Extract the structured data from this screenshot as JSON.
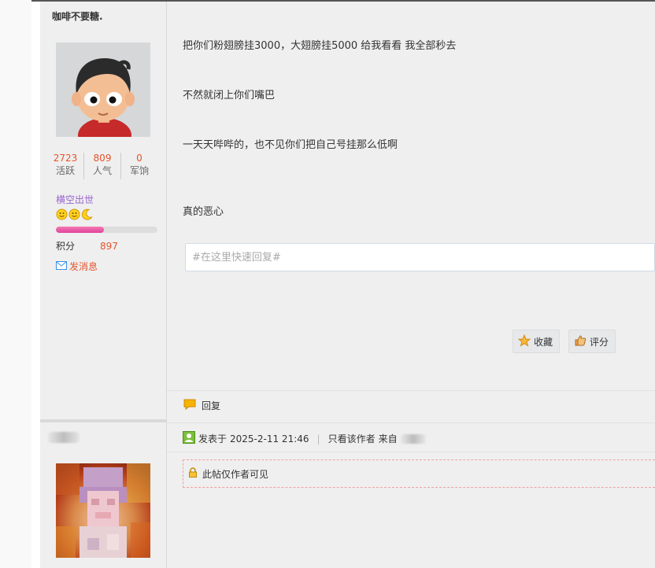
{
  "post1": {
    "author": "咖啡不要糖.",
    "stats": [
      {
        "value": "2723",
        "label": "活跃"
      },
      {
        "value": "809",
        "label": "人气"
      },
      {
        "value": "0",
        "label": "军饷"
      }
    ],
    "group": "横空出世",
    "level_progress": 0.47,
    "points_label": "积分",
    "points_value": "897",
    "send_message": "发消息",
    "paragraphs": [
      "把你们粉翅膀挂3000，大翅膀挂5000  给我看看   我全部秒去",
      "不然就闭上你们嘴巴",
      "一天天哔哔的，也不见你们把自己号挂那么低啊",
      "真的恶心"
    ],
    "quick_reply_placeholder": "#在这里快速回复#",
    "favorite_label": "收藏",
    "rate_label": "评分",
    "reply_label": "回复"
  },
  "post2": {
    "posted_prefix": "发表于",
    "posted_time": "2025-2-11 21:46",
    "only_author": "只看该作者",
    "from_label": "来自",
    "locked_notice": "此帖仅作者可见"
  },
  "colors": {
    "accent_orange": "#e4542b",
    "group_purple": "#9966cc",
    "progress_pink": "#e0419a"
  }
}
